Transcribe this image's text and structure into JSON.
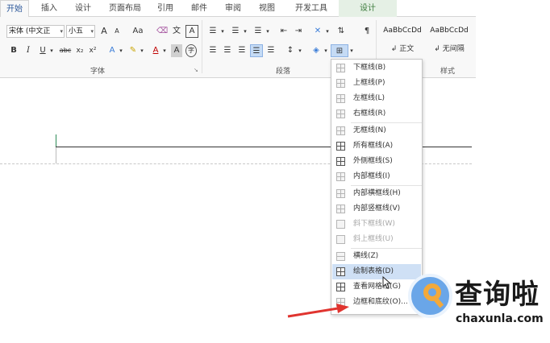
{
  "tabs": [
    "开始",
    "插入",
    "设计",
    "页面布局",
    "引用",
    "邮件",
    "审阅",
    "视图",
    "开发工具",
    "设计"
  ],
  "active_tab": "开始",
  "font_group": {
    "label": "字体",
    "font_name": "宋体 (中文正",
    "font_size": "小五",
    "grow_font": "A",
    "shrink_font": "A",
    "change_case": "Aa",
    "bold": "B",
    "italic": "I",
    "underline": "U",
    "strike": "abc",
    "subscript": "x₂",
    "superscript": "x²",
    "text_effects": "A",
    "font_color": "A",
    "char_shading": "A",
    "enclose": "字"
  },
  "paragraph_group": {
    "label": "段落"
  },
  "styles_group": {
    "label": "样式",
    "items": [
      {
        "sample": "AaBbCcDd",
        "name": "正文"
      },
      {
        "sample": "AaBbCcDd",
        "name": "无间隔"
      }
    ]
  },
  "colors": {
    "accent": "#2b579a",
    "tool_tab_bg": "#e5f0e5",
    "menu_hover": "#cde1f7",
    "arrow": "#e0342f",
    "watermark_circle": "#6aa6e8",
    "watermark_q": "#f3a93b"
  },
  "border_menu": {
    "items": [
      {
        "label": "下框线(B)",
        "icon": "bottom-border-icon",
        "enabled": true
      },
      {
        "label": "上框线(P)",
        "icon": "top-border-icon",
        "enabled": true
      },
      {
        "label": "左框线(L)",
        "icon": "left-border-icon",
        "enabled": true
      },
      {
        "label": "右框线(R)",
        "icon": "right-border-icon",
        "enabled": true
      },
      {
        "label": "无框线(N)",
        "icon": "no-border-icon",
        "enabled": true
      },
      {
        "label": "所有框线(A)",
        "icon": "all-borders-icon",
        "enabled": true
      },
      {
        "label": "外侧框线(S)",
        "icon": "outside-borders-icon",
        "enabled": true
      },
      {
        "label": "内部框线(I)",
        "icon": "inside-borders-icon",
        "enabled": true
      },
      {
        "label": "内部横框线(H)",
        "icon": "inside-horizontal-border-icon",
        "enabled": true
      },
      {
        "label": "内部竖框线(V)",
        "icon": "inside-vertical-border-icon",
        "enabled": true
      },
      {
        "label": "斜下框线(W)",
        "icon": "diagonal-down-border-icon",
        "enabled": false
      },
      {
        "label": "斜上框线(U)",
        "icon": "diagonal-up-border-icon",
        "enabled": false
      },
      {
        "label": "横线(Z)",
        "icon": "horizontal-line-icon",
        "enabled": true
      },
      {
        "label": "绘制表格(D)",
        "icon": "draw-table-icon",
        "enabled": true
      },
      {
        "label": "查看网格线(G)",
        "icon": "view-gridlines-icon",
        "enabled": true
      },
      {
        "label": "边框和底纹(O)...",
        "icon": "borders-shading-icon",
        "enabled": true
      }
    ]
  },
  "watermark": {
    "logo_text": "查询啦",
    "domain": "chaxunla.com"
  }
}
